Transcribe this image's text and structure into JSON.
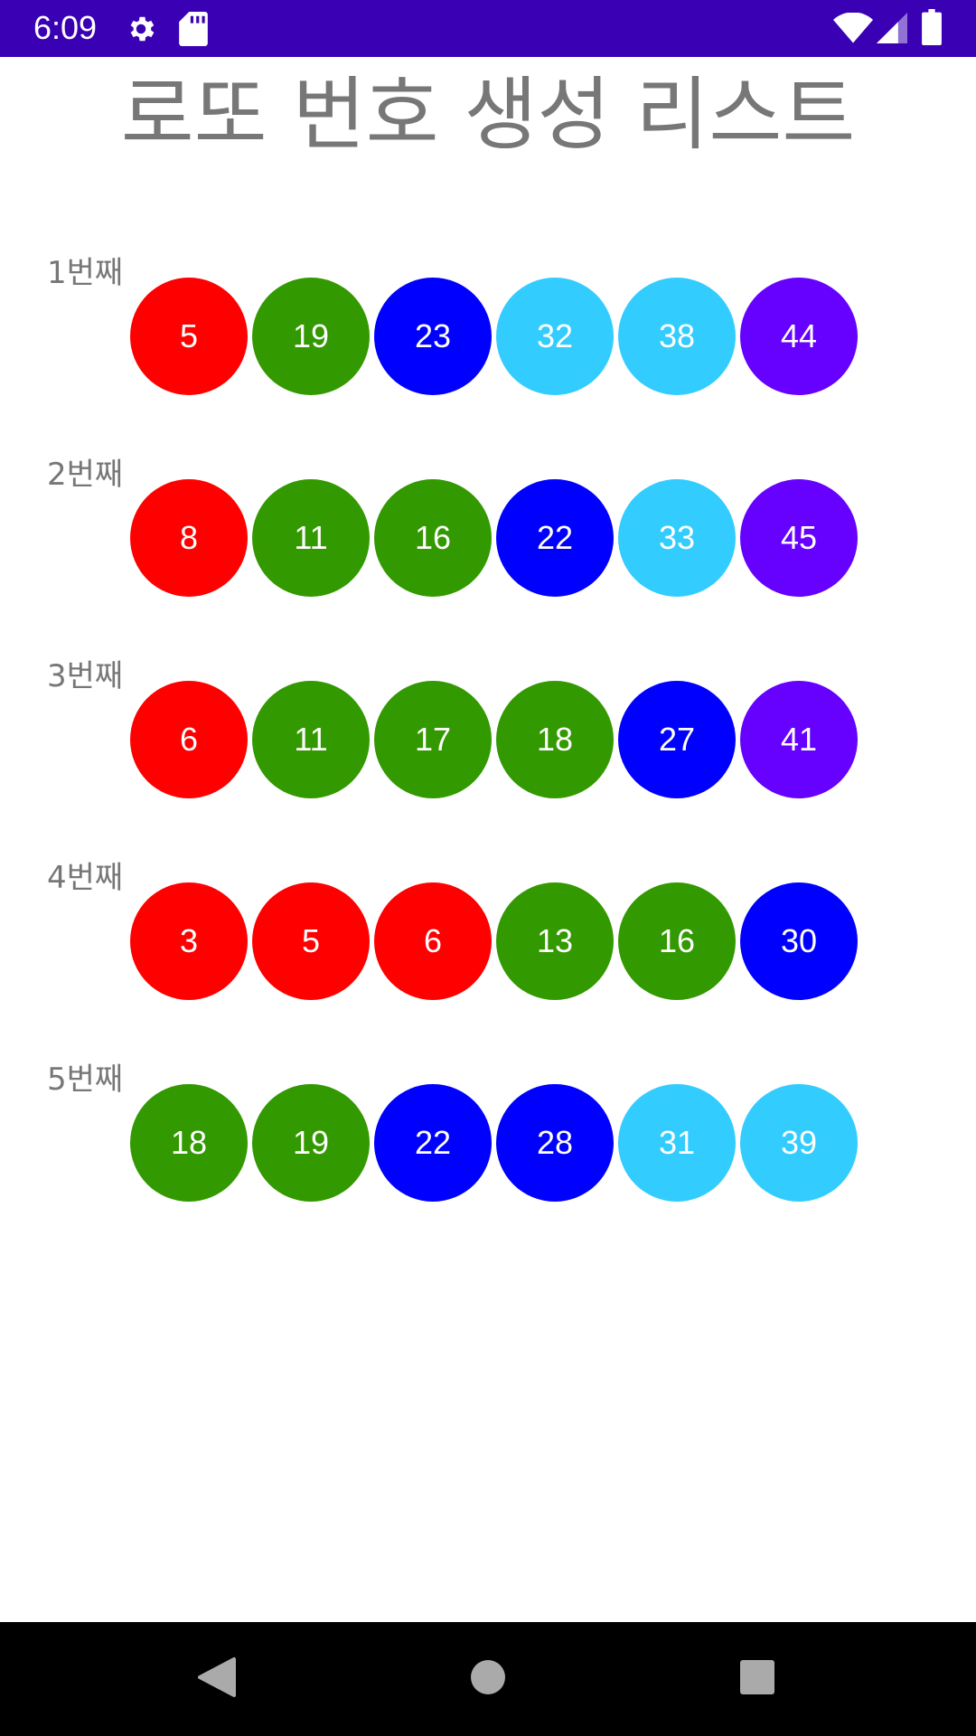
{
  "status_bar": {
    "time": "6:09",
    "background": "#3a00b3",
    "icons": [
      "gear-icon",
      "sd-card-icon",
      "wifi-icon",
      "signal-icon",
      "battery-icon"
    ]
  },
  "title": "로또 번호 생성 리스트",
  "colors": {
    "red": "#ff0000",
    "green": "#339900",
    "blue": "#0000ff",
    "cyan": "#33ccff",
    "purple": "#6600ff",
    "label_gray": "#777777"
  },
  "rows": [
    {
      "label": "1번째",
      "numbers": [
        "5",
        "19",
        "23",
        "32",
        "38",
        "44"
      ],
      "colors": [
        "#ff0000",
        "#339900",
        "#0000ff",
        "#33ccff",
        "#33ccff",
        "#6600ff"
      ]
    },
    {
      "label": "2번째",
      "numbers": [
        "8",
        "11",
        "16",
        "22",
        "33",
        "45"
      ],
      "colors": [
        "#ff0000",
        "#339900",
        "#339900",
        "#0000ff",
        "#33ccff",
        "#6600ff"
      ]
    },
    {
      "label": "3번째",
      "numbers": [
        "6",
        "11",
        "17",
        "18",
        "27",
        "41"
      ],
      "colors": [
        "#ff0000",
        "#339900",
        "#339900",
        "#339900",
        "#0000ff",
        "#6600ff"
      ]
    },
    {
      "label": "4번째",
      "numbers": [
        "3",
        "5",
        "6",
        "13",
        "16",
        "30"
      ],
      "colors": [
        "#ff0000",
        "#ff0000",
        "#ff0000",
        "#339900",
        "#339900",
        "#0000ff"
      ]
    },
    {
      "label": "5번째",
      "numbers": [
        "18",
        "19",
        "22",
        "28",
        "31",
        "39"
      ],
      "colors": [
        "#339900",
        "#339900",
        "#0000ff",
        "#0000ff",
        "#33ccff",
        "#33ccff"
      ]
    }
  ],
  "nav_bar": {
    "icons": [
      "back-icon",
      "home-icon",
      "recents-icon"
    ]
  }
}
